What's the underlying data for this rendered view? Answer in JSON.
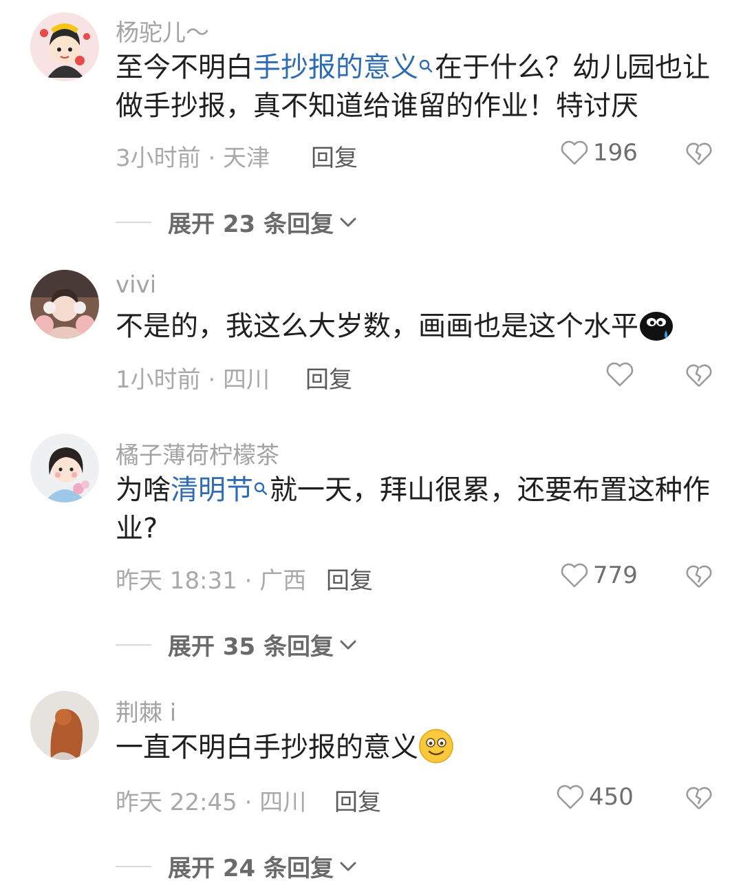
{
  "comments": [
    {
      "username": "杨驼儿～",
      "text_before": "至今不明白",
      "link": "手抄报的意义",
      "text_after": "在于什么？幼儿园也让做手抄报，真不知道给谁留的作业！特讨厌",
      "meta": "3小时前 · 天津",
      "reply": "回复",
      "likes": "196",
      "expand": "展开 23 条回复",
      "avatar": "cartoon-girl-avatar"
    },
    {
      "username": "vivi",
      "text": "不是的，我这么大岁数，画画也是这个水平",
      "emoji": "crying-blob-emoji",
      "meta": "1小时前 · 四川",
      "reply": "回复",
      "avatar": "photo-girl-earmuffs-avatar"
    },
    {
      "username": "橘子薄荷柠檬茶",
      "text_before": "为啥",
      "link": "清明节",
      "text_after": "就一天，拜山很累，还要布置这种作业?",
      "meta": "昨天 18:31 · 广西",
      "reply": "回复",
      "likes": "779",
      "expand": "展开 35 条回复",
      "avatar": "illustrated-girl-flowers-avatar"
    },
    {
      "username": "荆棘 i",
      "text": "一直不明白手抄报的意义",
      "emoji": "smile-emoji",
      "meta": "昨天 22:45 · 四川",
      "reply": "回复",
      "likes": "450",
      "expand": "展开 24 条回复",
      "avatar": "photo-red-hair-avatar"
    }
  ],
  "colors": {
    "link": "#2d6bb3",
    "meta": "#a9a9a9",
    "username": "#a3a3a3"
  }
}
